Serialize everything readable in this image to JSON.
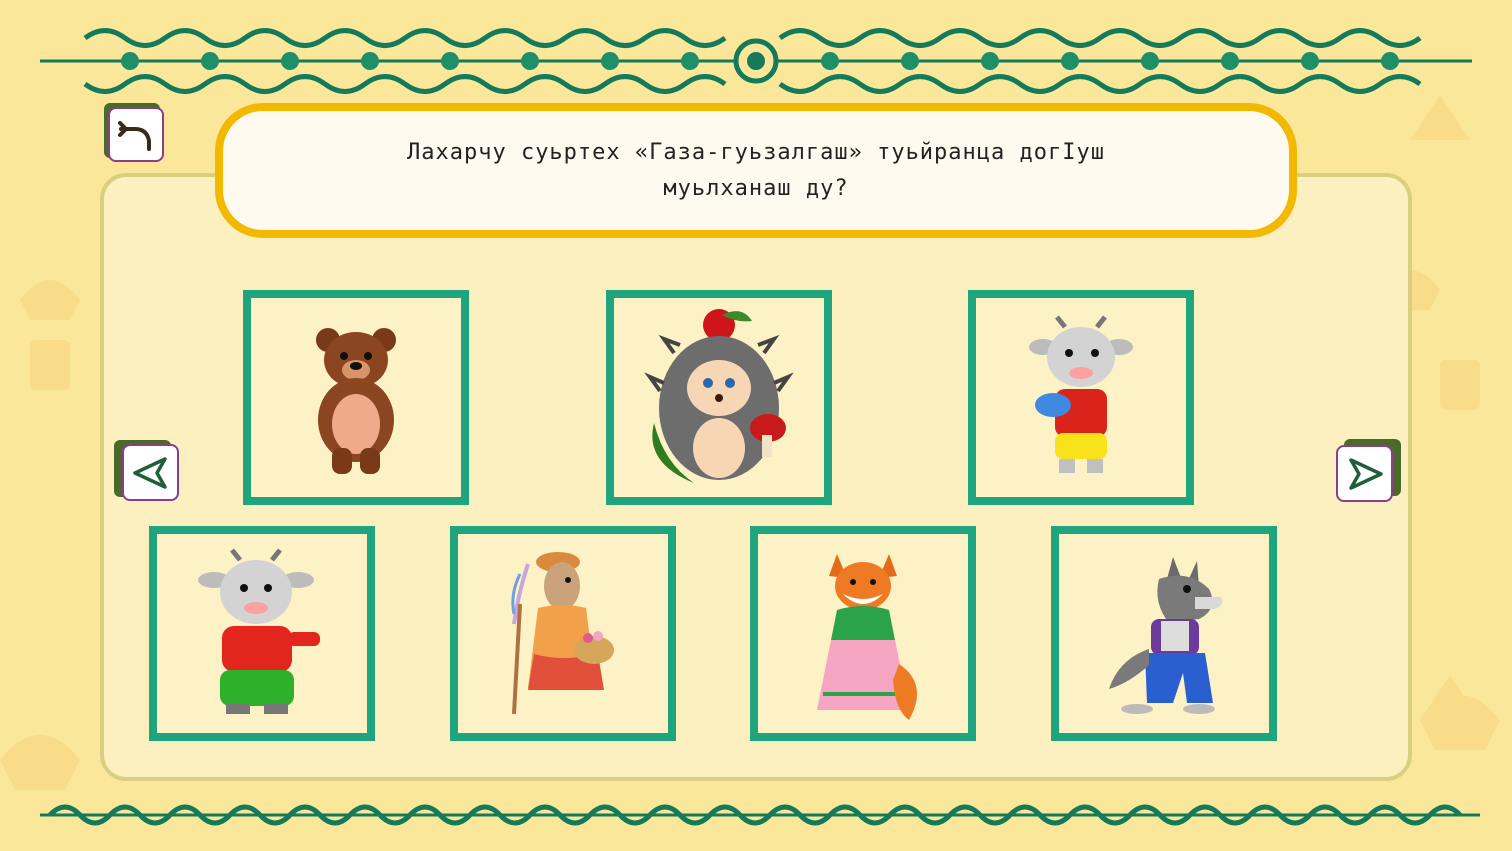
{
  "question": {
    "line1": "Лахарчу суьртех «Газа-гуьзалгаш» туьйранца догIуш",
    "line2": "муьлханаш ду?"
  },
  "buttons": {
    "back_icon": "back-arrow-icon",
    "prev_icon": "left-triangle-icon",
    "next_icon": "right-triangle-icon"
  },
  "cards": [
    {
      "icon": "bear-icon"
    },
    {
      "icon": "hedgehog-icon"
    },
    {
      "icon": "goat-kid-blue-shirt-icon"
    },
    {
      "icon": "goat-kid-red-shirt-icon"
    },
    {
      "icon": "mother-goat-icon"
    },
    {
      "icon": "fox-icon"
    },
    {
      "icon": "wolf-icon"
    }
  ],
  "colors": {
    "background": "#fbe79a",
    "accent_green": "#1fa57e",
    "question_border": "#f3b800",
    "button_border": "#8a3d8a"
  }
}
